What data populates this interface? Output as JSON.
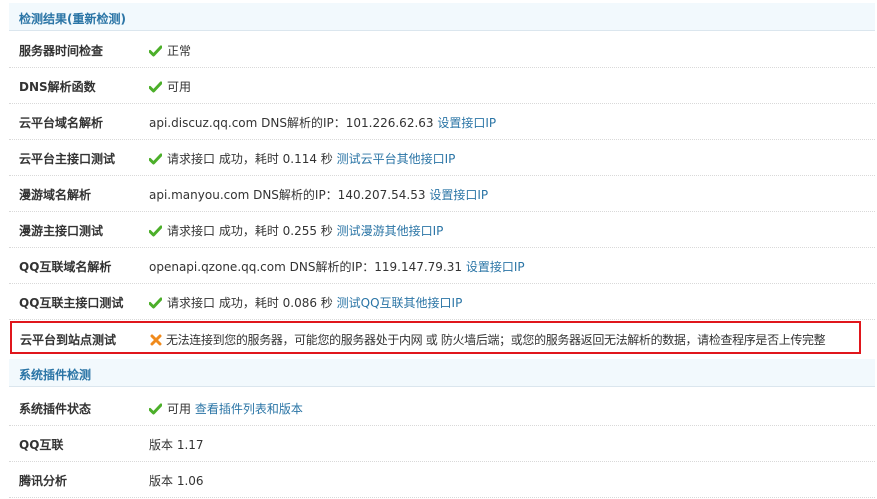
{
  "sections": [
    {
      "title": "检测结果(重新检测)",
      "rows": [
        {
          "label": "服务器时间检查",
          "status": "ok",
          "text": "正常",
          "link": ""
        },
        {
          "label": "DNS解析函数",
          "status": "ok",
          "text": "可用",
          "link": ""
        },
        {
          "label": "云平台域名解析",
          "status": "none",
          "text": "api.discuz.qq.com DNS解析的IP：101.226.62.63",
          "link": "设置接口IP"
        },
        {
          "label": "云平台主接口测试",
          "status": "ok",
          "text": "请求接口 成功，耗时 0.114 秒",
          "link": "测试云平台其他接口IP"
        },
        {
          "label": "漫游域名解析",
          "status": "none",
          "text": "api.manyou.com DNS解析的IP：140.207.54.53",
          "link": "设置接口IP"
        },
        {
          "label": "漫游主接口测试",
          "status": "ok",
          "text": "请求接口 成功，耗时 0.255 秒",
          "link": "测试漫游其他接口IP"
        },
        {
          "label": "QQ互联域名解析",
          "status": "none",
          "text": "openapi.qzone.qq.com DNS解析的IP：119.147.79.31",
          "link": "设置接口IP"
        },
        {
          "label": "QQ互联主接口测试",
          "status": "ok",
          "text": "请求接口 成功，耗时 0.086 秒",
          "link": "测试QQ互联其他接口IP"
        },
        {
          "label": "云平台到站点测试",
          "status": "error",
          "text": "无法连接到您的服务器，可能您的服务器处于内网 或 防火墙后端；或您的服务器返回无法解析的数据，请检查程序是否上传完整",
          "link": ""
        }
      ]
    },
    {
      "title": "系统插件检测",
      "rows": [
        {
          "label": "系统插件状态",
          "status": "ok",
          "text": "可用",
          "link": "查看插件列表和版本"
        },
        {
          "label": "QQ互联",
          "status": "none",
          "text": "版本 1.17",
          "link": ""
        },
        {
          "label": "腾讯分析",
          "status": "none",
          "text": "版本 1.06",
          "link": ""
        }
      ]
    }
  ],
  "colors": {
    "header_bg": "#f2f9fd",
    "header_text": "#2b75a6",
    "link": "#2b75a6",
    "ok_icon": "#4caf2a",
    "error_icon": "#f08a1c",
    "highlight_border": "#e0161c"
  },
  "icons": {
    "ok": "check-icon",
    "error": "cross-icon"
  }
}
